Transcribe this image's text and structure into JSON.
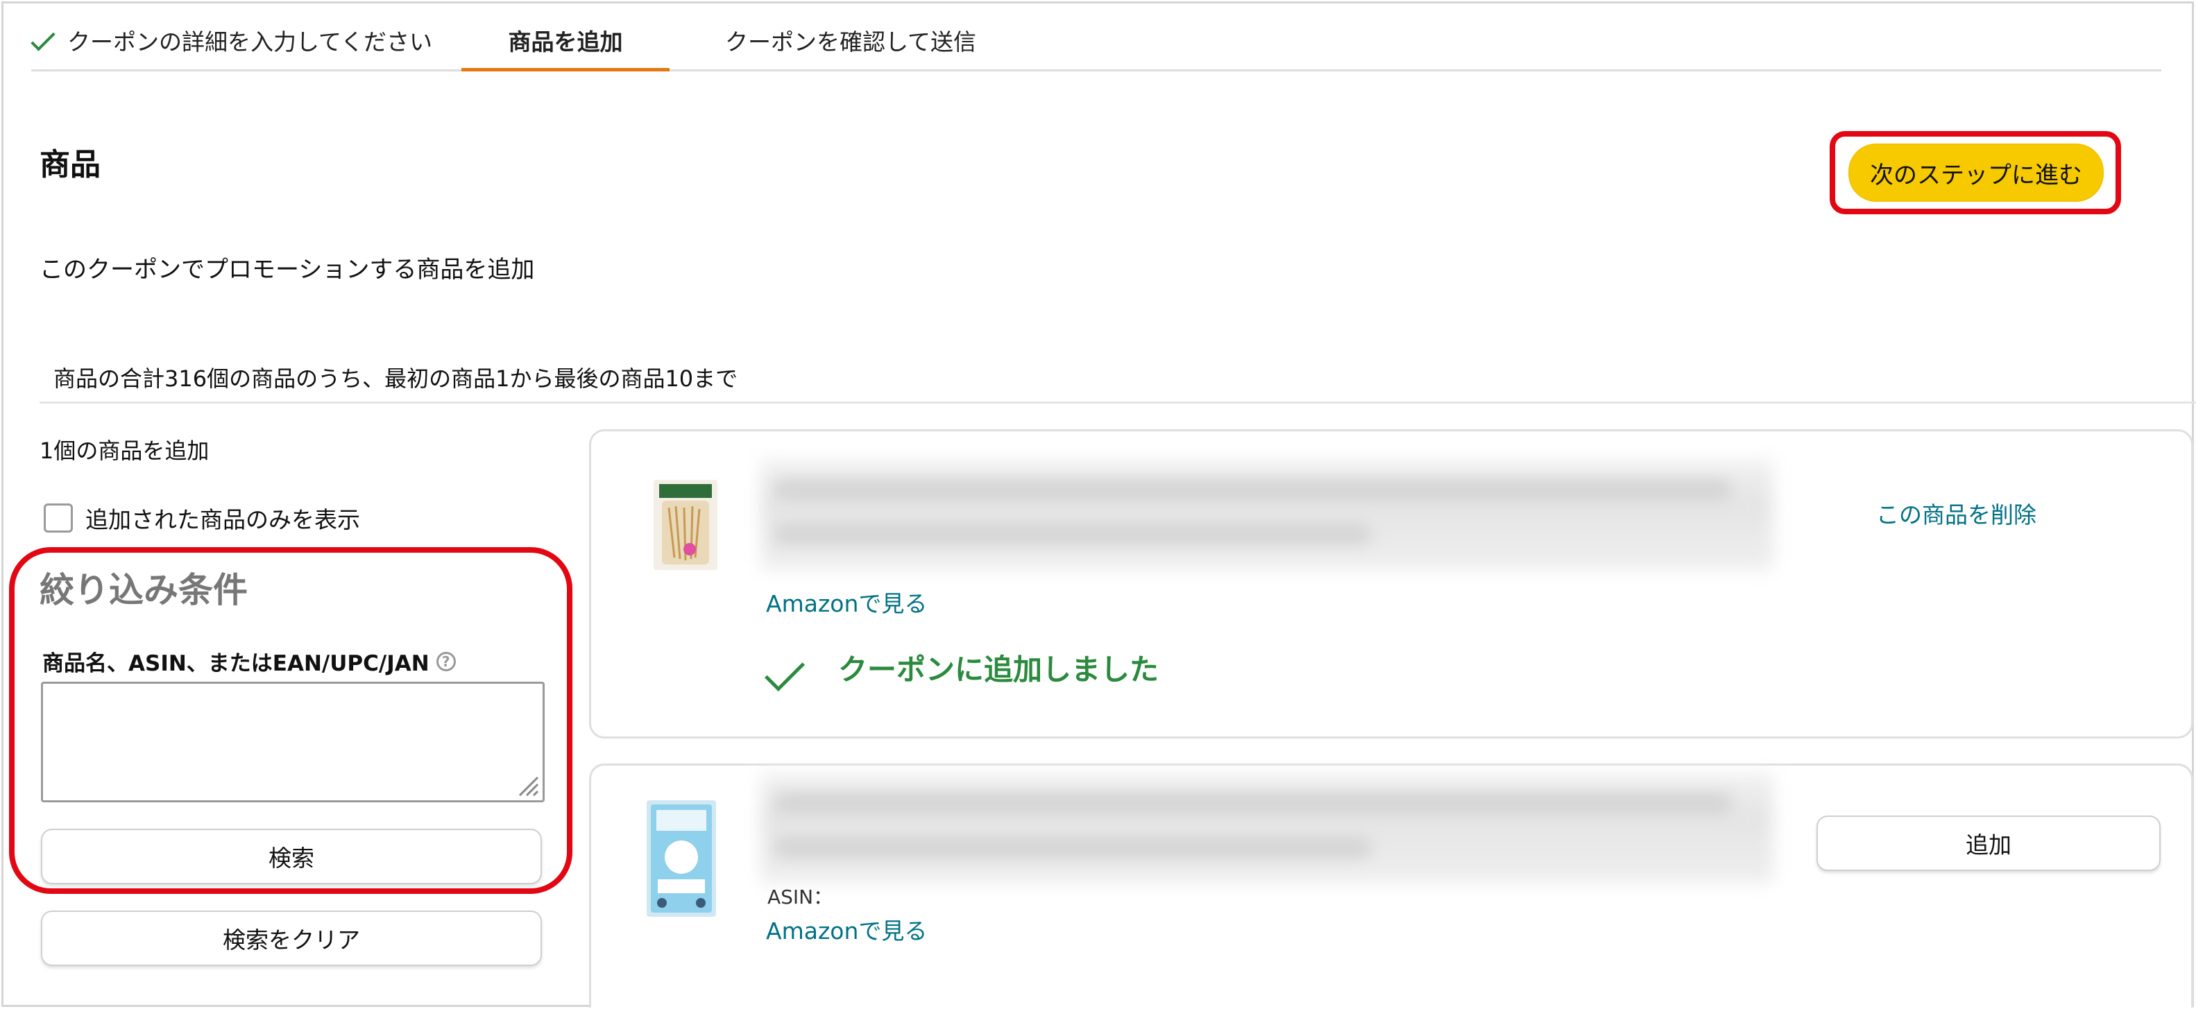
{
  "steps": {
    "done": "クーポンの詳細を入力してください",
    "active": "商品を追加",
    "next": "クーポンを確認して送信"
  },
  "header": {
    "title": "商品",
    "next_button": "次のステップに進む"
  },
  "subtitle": "このクーポンでプロモーションする商品を追加",
  "range_text": "商品の合計316個の商品のうち、最初の商品1から最後の商品10まで",
  "left": {
    "added_count": "1個の商品を追加",
    "only_added_label": "追加された商品のみを表示",
    "only_added_checked": false,
    "filter_title": "絞り込み条件",
    "filter_label": "商品名、ASIN、またはEAN/UPC/JAN",
    "filter_value": "",
    "search_button": "検索",
    "clear_button": "検索をクリア"
  },
  "products": [
    {
      "remove_link": "この商品を削除",
      "amazon_link": "Amazonで見る",
      "status": "クーポンに追加しました"
    },
    {
      "asin_label": "ASIN：",
      "amazon_link": "Amazonで見る",
      "add_button": "追加"
    }
  ],
  "colors": {
    "accent_orange": "#e47911",
    "primary_button": "#f7ca00",
    "link": "#007185",
    "success": "#2b8a3e",
    "highlight_red": "#e30613"
  }
}
